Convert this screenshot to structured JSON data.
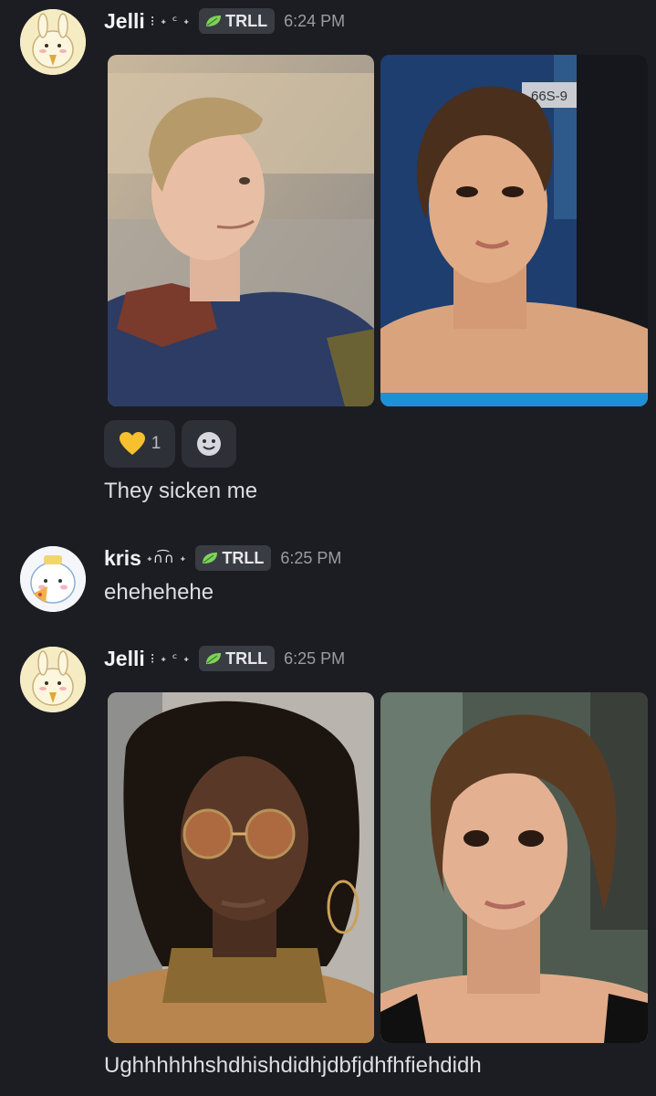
{
  "messages": [
    {
      "username": "Jelli",
      "decoration": "⁝ ˖ ᶜ ˖",
      "tag": "TRLL",
      "time": "6:24 PM",
      "reaction": {
        "emoji": "💛",
        "count": "1",
        "add_icon": "add-reaction-icon"
      },
      "text": "They sicken me"
    },
    {
      "username": "kris",
      "decoration": "˖∩͡∩ ˖",
      "tag": "TRLL",
      "time": "6:25 PM",
      "text": "ehehehehe"
    },
    {
      "username": "Jelli",
      "decoration": "⁝ ˖ ᶜ ˖",
      "tag": "TRLL",
      "time": "6:25 PM",
      "text": "Ughhhhhhshdhishdidhjdbfjdhfhfiehdidh"
    }
  ],
  "photo_labels": {
    "locker_sign": "66S-9"
  },
  "colors": {
    "background": "#1c1d22",
    "tag_leaf": "#7ed35a",
    "reaction_bg": "#2e3037"
  }
}
